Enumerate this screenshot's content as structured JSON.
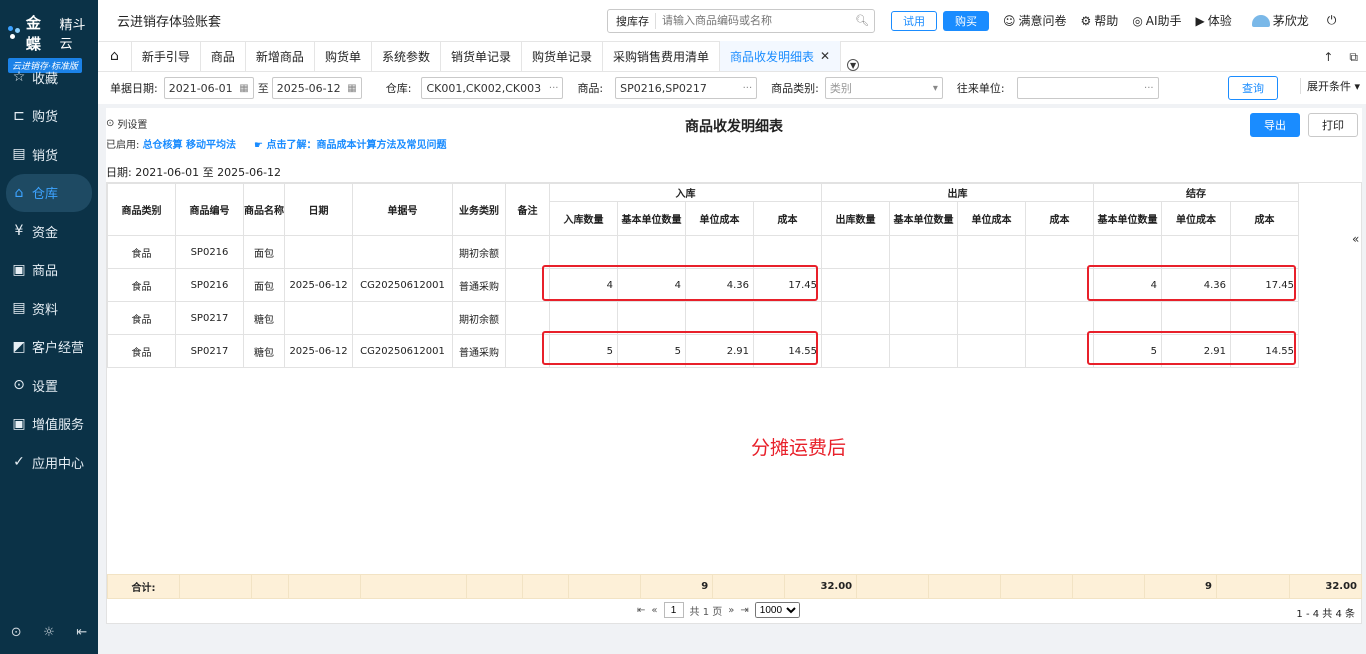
{
  "brand": {
    "name": "金蝶",
    "sub": "精斗云",
    "edition": "云进销存·标准版"
  },
  "sidebar": {
    "items": [
      {
        "label": "收藏",
        "icon": "star-icon"
      },
      {
        "label": "购货",
        "icon": "cart-icon"
      },
      {
        "label": "销货",
        "icon": "receipt-icon"
      },
      {
        "label": "仓库",
        "icon": "warehouse-icon"
      },
      {
        "label": "资金",
        "icon": "money-icon"
      },
      {
        "label": "商品",
        "icon": "goods-icon"
      },
      {
        "label": "资料",
        "icon": "document-icon"
      },
      {
        "label": "客户经营",
        "icon": "customer-icon"
      },
      {
        "label": "设置",
        "icon": "gear-icon"
      },
      {
        "label": "增值服务",
        "icon": "service-icon"
      },
      {
        "label": "应用中心",
        "icon": "apps-icon"
      }
    ]
  },
  "header": {
    "account": "云进销存体验账套",
    "search_type": "搜库存",
    "search_placeholder": "请输入商品编码或名称",
    "trial": "试用",
    "buy": "购买",
    "links": [
      "满意问卷",
      "帮助",
      "AI助手",
      "体验"
    ],
    "user": "茅欣龙"
  },
  "tabs": [
    "新手引导",
    "商品",
    "新增商品",
    "购货单",
    "系统参数",
    "销货单记录",
    "购货单记录",
    "采购销售费用清单",
    "商品收发明细表"
  ],
  "filters": {
    "date_label": "单据日期:",
    "date_from": "2021-06-01",
    "to": "至",
    "date_to": "2025-06-12",
    "warehouse_label": "仓库:",
    "warehouse": "CK001,CK002,CK003",
    "goods_label": "商品:",
    "goods": "SP0216,SP0217",
    "category_label": "商品类别:",
    "category_placeholder": "类别",
    "partner_label": "往来单位:",
    "query": "查询",
    "expand": "展开条件"
  },
  "report": {
    "col_settings": "列设置",
    "title": "商品收发明细表",
    "export": "导出",
    "print": "打印",
    "enabled_label": "已启用:",
    "enabled_value": "总仓核算 移动平均法",
    "learn_more": "☛ 点击了解：商品成本计算方法及常见问题",
    "date_range": "日期: 2021-06-01 至 2025-06-12"
  },
  "table": {
    "headers": [
      "商品类别",
      "商品编号",
      "商品名称",
      "日期",
      "单据号",
      "业务类别",
      "备注"
    ],
    "groups": [
      "入库",
      "出库",
      "结存"
    ],
    "in_cols": [
      "入库数量",
      "基本单位数量",
      "单位成本",
      "成本"
    ],
    "out_cols": [
      "出库数量",
      "基本单位数量",
      "单位成本",
      "成本"
    ],
    "bal_cols": [
      "基本单位数量",
      "单位成本",
      "成本"
    ],
    "rows": [
      [
        "食品",
        "SP0216",
        "面包",
        "",
        "",
        "期初余额",
        "",
        "",
        "",
        "",
        "",
        "",
        "",
        "",
        "",
        "",
        "",
        ""
      ],
      [
        "食品",
        "SP0216",
        "面包",
        "2025-06-12",
        "CG20250612001",
        "普通采购",
        "",
        "4",
        "4",
        "4.36",
        "17.45",
        "",
        "",
        "",
        "",
        "4",
        "4.36",
        "17.45"
      ],
      [
        "食品",
        "SP0217",
        "糖包",
        "",
        "",
        "期初余额",
        "",
        "",
        "",
        "",
        "",
        "",
        "",
        "",
        "",
        "",
        "",
        ""
      ],
      [
        "食品",
        "SP0217",
        "糖包",
        "2025-06-12",
        "CG20250612001",
        "普通采购",
        "",
        "5",
        "5",
        "2.91",
        "14.55",
        "",
        "",
        "",
        "",
        "5",
        "2.91",
        "14.55"
      ]
    ],
    "total_label": "合计:",
    "totals": {
      "in_qty": "9",
      "in_cost": "32.00",
      "bal_qty": "9",
      "bal_cost": "32.00"
    }
  },
  "annotation": "分摊运费后",
  "pager": {
    "page": "1",
    "total_pages": "共 1 页",
    "size": "1000",
    "count": "1 - 4 共 4 条"
  }
}
